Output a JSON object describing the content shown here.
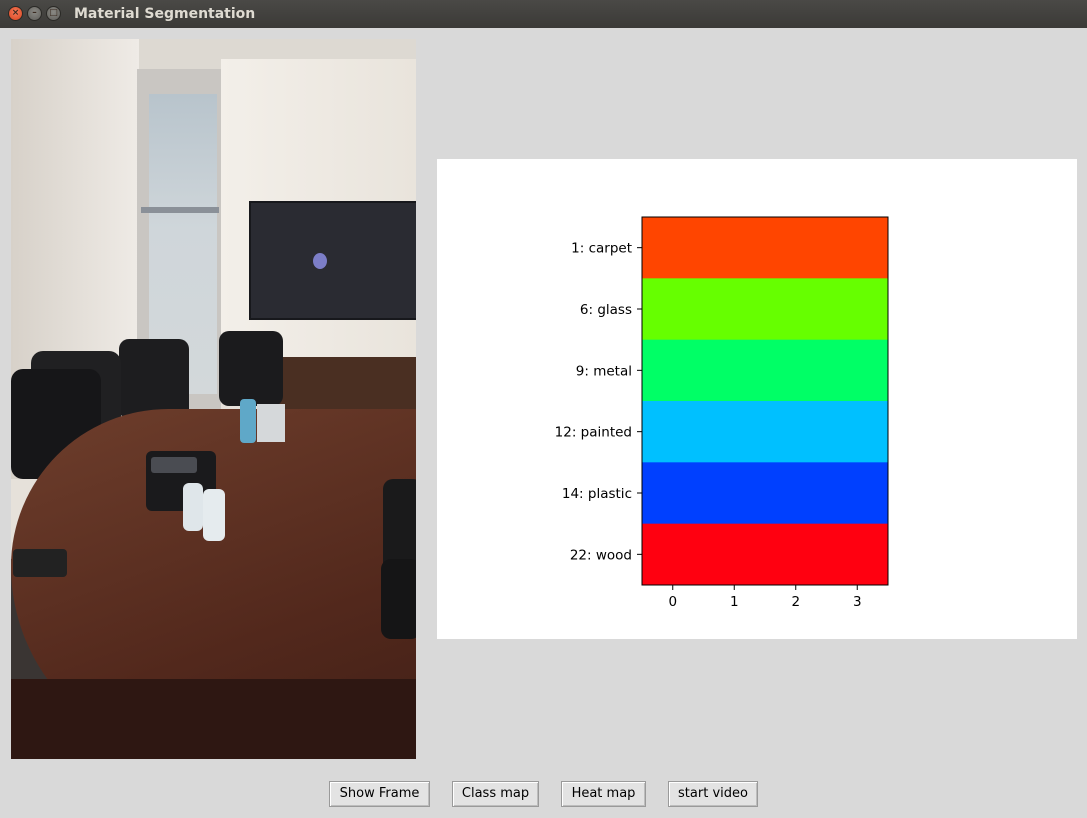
{
  "window": {
    "title": "Material Segmentation"
  },
  "buttons": {
    "show_frame": "Show Frame",
    "class_map": "Class map",
    "heat_map": "Heat map",
    "start_video": "start video"
  },
  "chart_data": {
    "type": "heatmap",
    "title": "",
    "xlabel": "",
    "ylabel": "",
    "x": [
      0,
      1,
      2,
      3
    ],
    "xlim": [
      -0.5,
      3.5
    ],
    "categories": [
      "1: carpet",
      "6: glass",
      "9: metal",
      "12: painted",
      "14: plastic",
      "22: wood"
    ],
    "colors": [
      "#ff4500",
      "#66ff00",
      "#00ff66",
      "#00c0ff",
      "#0040ff",
      "#ff0010"
    ],
    "grid": false
  }
}
